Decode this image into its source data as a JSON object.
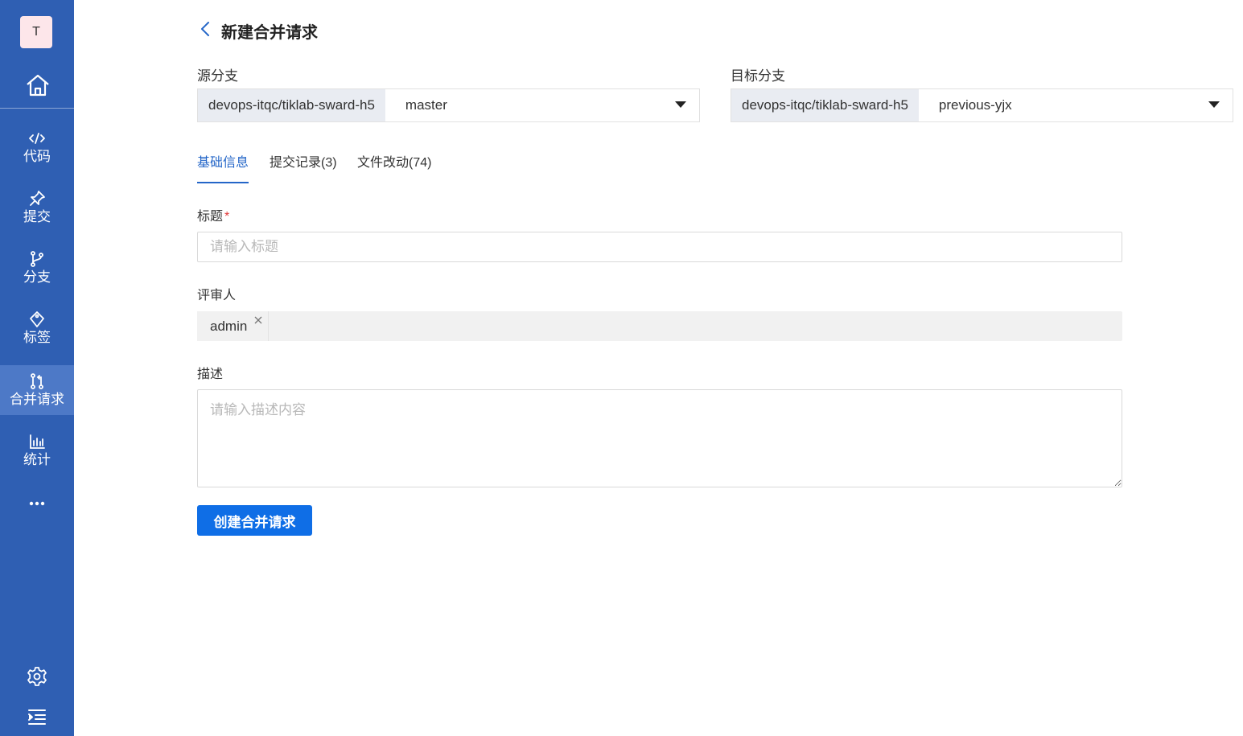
{
  "sidebar": {
    "avatar_letter": "T",
    "home_icon": "home-icon",
    "items": [
      {
        "label": "代码",
        "icon": "code-icon"
      },
      {
        "label": "提交",
        "icon": "pin-icon"
      },
      {
        "label": "分支",
        "icon": "branch-icon"
      },
      {
        "label": "标签",
        "icon": "tag-icon"
      },
      {
        "label": "合并请求",
        "icon": "merge-request-icon",
        "active": true
      },
      {
        "label": "统计",
        "icon": "bar-chart-icon"
      }
    ],
    "more_icon": "more-icon",
    "settings_icon": "gear-icon",
    "collapse_icon": "menu-indent-icon",
    "background": "#2f5fb3",
    "active_background": "#4d79c7"
  },
  "header": {
    "title": "新建合并请求",
    "back_icon": "chevron-left-icon"
  },
  "source": {
    "label": "源分支",
    "repo": "devops-itqc/tiklab-sward-h5",
    "branch": "master"
  },
  "target": {
    "label": "目标分支",
    "repo": "devops-itqc/tiklab-sward-h5",
    "branch": "previous-yjx"
  },
  "tabs": [
    {
      "label": "基础信息",
      "active": true
    },
    {
      "label": "提交记录(3)"
    },
    {
      "label": "文件改动(74)"
    }
  ],
  "form": {
    "title_label": "标题",
    "required_mark": "*",
    "title_placeholder": "请输入标题",
    "reviewer_label": "评审人",
    "reviewer": "admin",
    "description_label": "描述",
    "description_placeholder": "请输入描述内容",
    "submit_label": "创建合并请求"
  },
  "colors": {
    "accent": "#2466c8",
    "button": "#0f6ee6",
    "required": "#e03a3a"
  }
}
